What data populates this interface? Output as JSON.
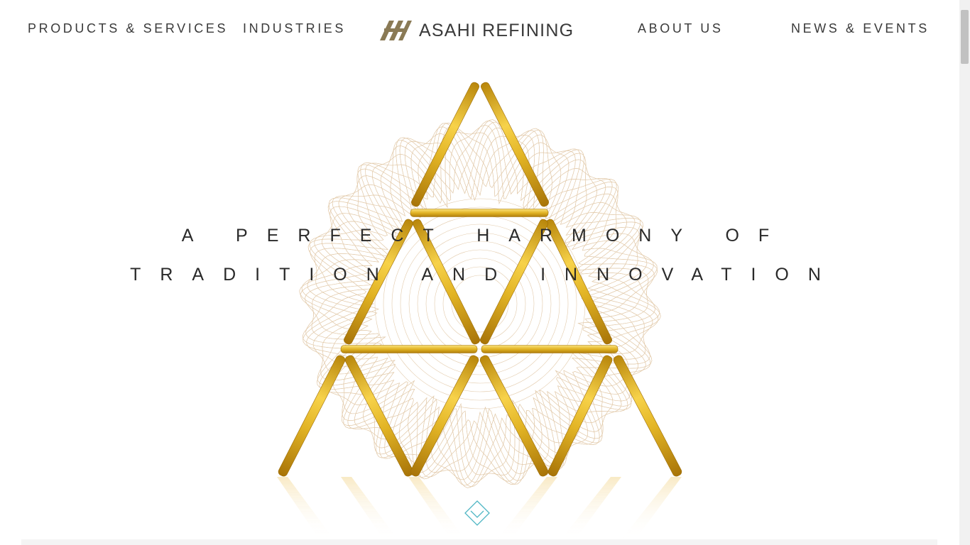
{
  "nav": {
    "products_services": "PRODUCTS & SERVICES",
    "industries": "INDUSTRIES",
    "about_us": "ABOUT US",
    "news_events": "NEWS & EVENTS"
  },
  "logo": {
    "brand": "ASAHI REFINING",
    "mark_icon": "asahi-logo-mark",
    "mark_color": "#8a7a55",
    "text_color": "#3a3a3a"
  },
  "hero": {
    "headline_line1": "A PERFECT HARMONY OF",
    "headline_line2": "TRADITION AND INNOVATION",
    "image_subject": "gold-bars-pyramid",
    "gold_color": "#e2b425"
  },
  "scroll_indicator": {
    "icon": "chevron-down-icon",
    "color": "#4fb6c4"
  }
}
